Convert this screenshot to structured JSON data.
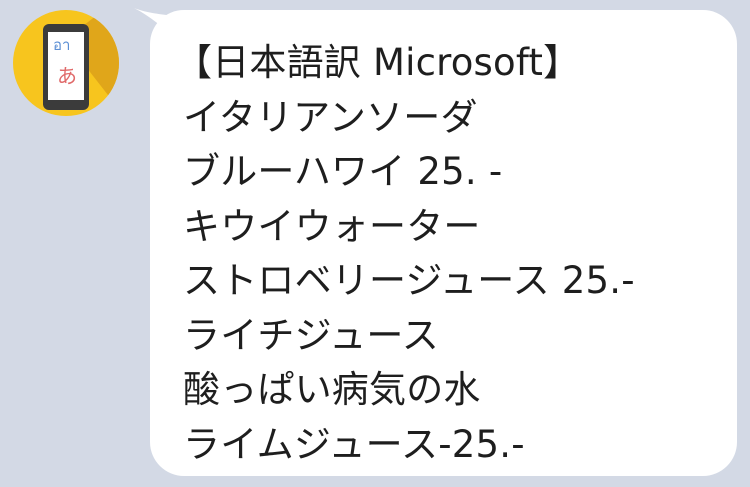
{
  "sender": {
    "avatar_icon": "translator-phone-icon",
    "avatar_glyph_top": "อา",
    "avatar_glyph_bottom": "あ",
    "colors": {
      "avatar_bg": "#f7c51e",
      "avatar_shadow": "#e0a61a",
      "phone_body": "#3b3b3b"
    }
  },
  "chat": {
    "background": "#d3d9e5",
    "bubble_color": "#ffffff",
    "message_lines": [
      "【日本語訳 Microsoft】",
      "イタリアンソーダ",
      "ブルーハワイ 25. -",
      "キウイウォーター",
      "ストロベリージュース 25.-",
      "ライチジュース",
      "酸っぱい病気の水",
      "ライムジュース-25.-"
    ]
  }
}
